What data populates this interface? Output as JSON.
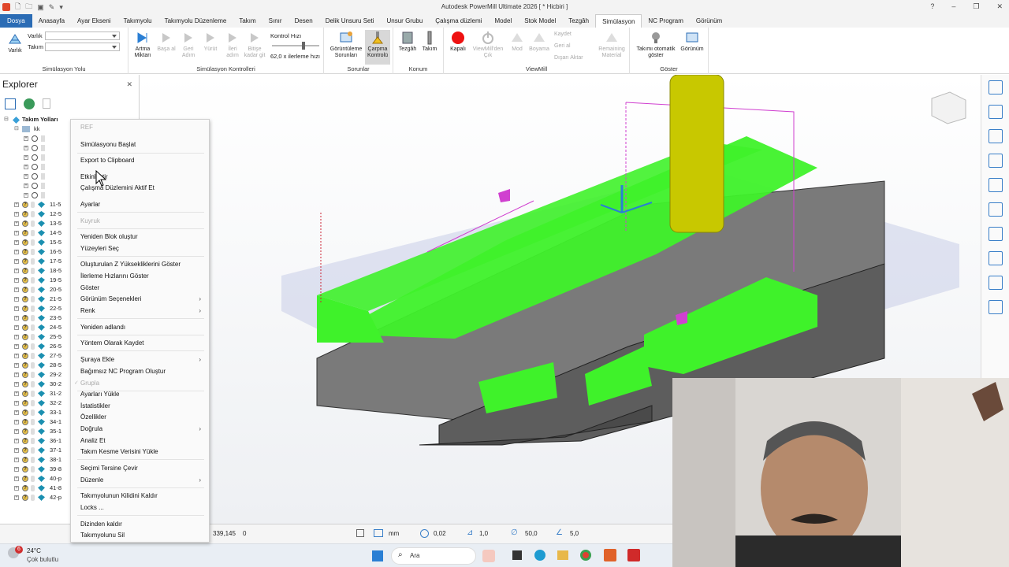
{
  "window": {
    "title": "Autodesk PowerMill Ultimate 2026  [ * Hicbiri ]"
  },
  "tabs": [
    "Dosya",
    "Anasayfa",
    "Ayar Ekseni",
    "Takımyolu",
    "Takımyolu Düzenleme",
    "Takım",
    "Sınır",
    "Desen",
    "Delik Unsuru Seti",
    "Unsur Grubu",
    "Çalışma düzlemi",
    "Model",
    "Stok Model",
    "Tezgâh",
    "Simülasyon",
    "NC Program",
    "Görünüm"
  ],
  "active_tab": "Simülasyon",
  "ribbon": {
    "sim_path": {
      "label": "Simülasyon Yolu",
      "varlik_btn": "Varlık",
      "varlik_label": "Varlık",
      "takim_label": "Takım"
    },
    "sim_controls": {
      "label": "Simülasyon Kontrolleri",
      "buttons": [
        "Artma Miktarı",
        "Başa al",
        "Geri Adım",
        "Yürüt",
        "İleri adım",
        "Bitişe kadar git"
      ],
      "speed_label": "Kontrol Hızı",
      "speed_value": "62,0 x ilerleme hızı"
    },
    "problems": {
      "label": "Sorunlar",
      "buttons": [
        "Görüntüleme Sorunları",
        "Çarpma Kontrolü"
      ]
    },
    "position": {
      "label": "Konum",
      "buttons": [
        "Tezgâh",
        "Takım"
      ]
    },
    "viewmill": {
      "label": "ViewMill",
      "buttons": [
        "Kapalı",
        "ViewMill'den Çık",
        "Mod",
        "Boyama"
      ],
      "small": [
        "Kaydet",
        "Geri al",
        "Dışarı Aktar",
        "Remaining Material"
      ]
    },
    "show": {
      "label": "Göster",
      "buttons": [
        "Takımı otomatik göster",
        "Görünüm"
      ]
    }
  },
  "explorer": {
    "title": "Explorer",
    "root": "Takım Yolları",
    "folder": "kk",
    "items": [
      "11-5",
      "12-5",
      "13-5",
      "14-5",
      "15-5",
      "16-5",
      "17-5",
      "18-5",
      "19-5",
      "20-5",
      "21-5",
      "22-5",
      "23-5",
      "24-5",
      "25-5",
      "26-5",
      "27-5",
      "28-5",
      "29-2",
      "30-2",
      "31-2",
      "32-2",
      "33-1",
      "34-1",
      "35-1",
      "36-1",
      "37-1",
      "38-1",
      "39-8",
      "40-p",
      "41-8",
      "42-p"
    ]
  },
  "context_menu": {
    "header": "REF",
    "items": [
      {
        "label": "Simülasyonu Başlat"
      },
      {
        "label": "Export to Clipboard"
      },
      {
        "label": "Etkinleştir"
      },
      {
        "label": "Çalışma Düzlemini Aktif Et"
      },
      {
        "label": "Ayarlar"
      },
      {
        "label": "Kuyruk",
        "disabled": true
      },
      {
        "label": "Yeniden Blok oluştur"
      },
      {
        "label": "Yüzeyleri Seç"
      },
      {
        "label": "Oluşturulan Z Yüksekliklerini Göster"
      },
      {
        "label": "İlerleme Hızlarını Göster"
      },
      {
        "label": "Göster"
      },
      {
        "label": "Görünüm Seçenekleri",
        "submenu": true
      },
      {
        "label": "Renk",
        "submenu": true
      },
      {
        "label": "Yeniden adlandı"
      },
      {
        "label": "Yöntem Olarak Kaydet"
      },
      {
        "label": "Şuraya Ekle",
        "submenu": true
      },
      {
        "label": "Bağımsız NC Program Oluştur"
      },
      {
        "label": "Grupla",
        "disabled": true
      },
      {
        "label": "Ayarları Yükle"
      },
      {
        "label": "İstatistikler"
      },
      {
        "label": "Özellikler"
      },
      {
        "label": "Doğrula",
        "submenu": true
      },
      {
        "label": "Analiz Et"
      },
      {
        "label": "Takım Kesme Verisini Yükle"
      },
      {
        "label": "Seçimi Tersine Çevir"
      },
      {
        "label": "Düzenle",
        "submenu": true
      },
      {
        "label": "Takımyolunun Kilidini Kaldır"
      },
      {
        "label": "Locks ..."
      },
      {
        "label": "Dizinden kaldır"
      },
      {
        "label": "Takımyolunu Sil"
      }
    ]
  },
  "statusbar": {
    "coord": "339,145",
    "z": "0",
    "unit": "mm",
    "tol": "0,02",
    "thick": "1,0",
    "dia": "50,0",
    "step": "5,0"
  },
  "taskbar": {
    "weather_temp": "24°C",
    "weather_desc": "Çok bulutlu",
    "notif": "6",
    "search": "Ara"
  },
  "colors": {
    "accent": "#2b6cb5",
    "toolpath": "#3ff22a",
    "tool": "#c8c800"
  }
}
